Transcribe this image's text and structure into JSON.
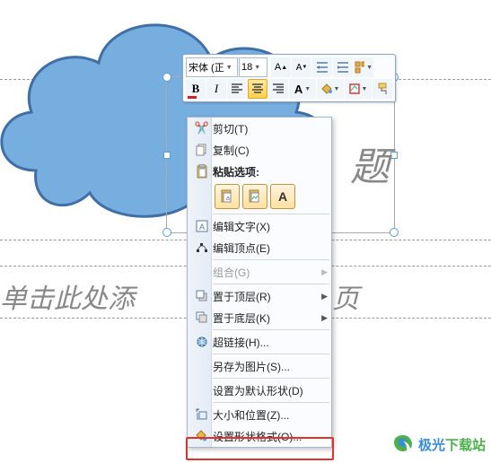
{
  "placeholders": {
    "title_fragment": "题",
    "subtitle_fragment": "单击此处添",
    "subtitle_tail": "页"
  },
  "miniToolbar": {
    "font_name": "宋体 (正",
    "font_size": "18",
    "bold": "B",
    "italic": "I"
  },
  "contextMenu": {
    "cut": "剪切(T)",
    "copy": "复制(C)",
    "paste_label": "粘贴选项:",
    "edit_text": "编辑文字(X)",
    "edit_points": "编辑顶点(E)",
    "group": "组合(G)",
    "bring_front": "置于顶层(R)",
    "send_back": "置于底层(K)",
    "hyperlink": "超链接(H)...",
    "save_as_pic": "另存为图片(S)...",
    "set_default_shape": "设置为默认形状(D)",
    "size_position": "大小和位置(Z)...",
    "format_shape": "设置形状格式(O)..."
  },
  "watermark": {
    "brand1": "极光",
    "brand2": "下载站"
  }
}
